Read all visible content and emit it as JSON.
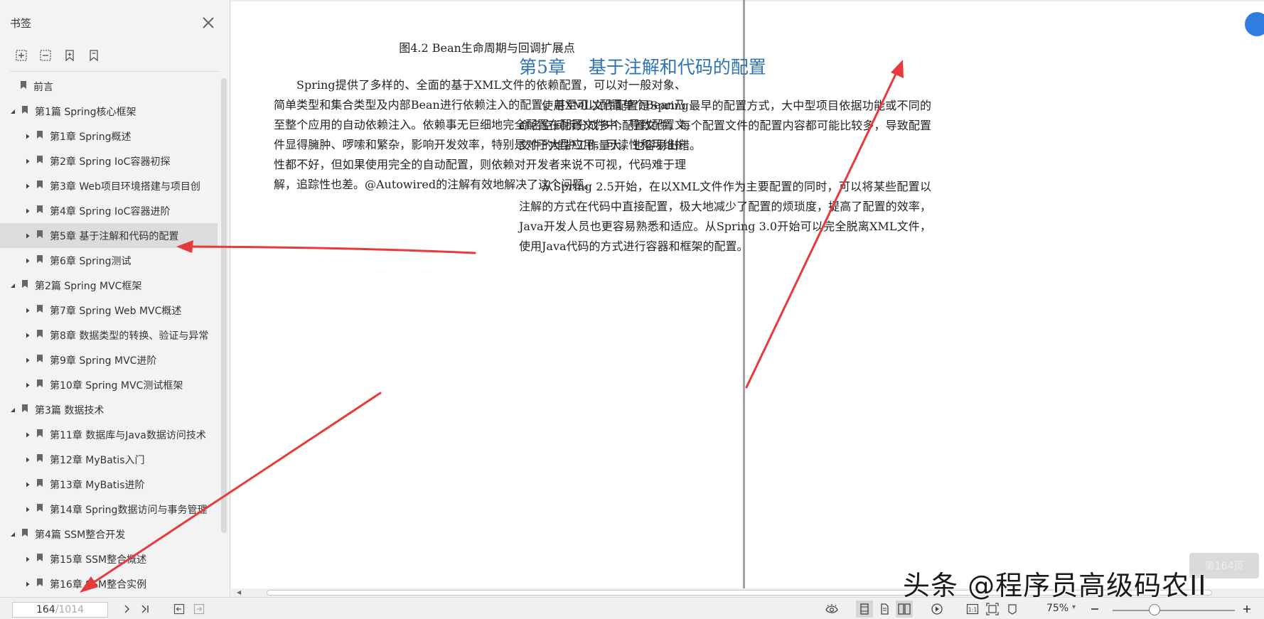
{
  "sidebar": {
    "title": "书签",
    "items": [
      {
        "label": "前言",
        "level": 0,
        "expanded": false
      },
      {
        "label": "第1篇 Spring核心框架",
        "level": 1,
        "expanded": true
      },
      {
        "label": "第1章 Spring概述",
        "level": 2,
        "expanded": false
      },
      {
        "label": "第2章 Spring IoC容器初探",
        "level": 2,
        "expanded": false
      },
      {
        "label": "第3章 Web项目环境搭建与项目创",
        "level": 2,
        "expanded": false
      },
      {
        "label": "第4章 Spring IoC容器进阶",
        "level": 2,
        "expanded": false
      },
      {
        "label": "第5章 基于注解和代码的配置",
        "level": 2,
        "expanded": false,
        "selected": true
      },
      {
        "label": "第6章 Spring测试",
        "level": 2,
        "expanded": false
      },
      {
        "label": "第2篇 Spring MVC框架",
        "level": 1,
        "expanded": true
      },
      {
        "label": "第7章 Spring Web MVC概述",
        "level": 2,
        "expanded": false
      },
      {
        "label": "第8章 数据类型的转换、验证与异常",
        "level": 2,
        "expanded": false
      },
      {
        "label": "第9章 Spring MVC进阶",
        "level": 2,
        "expanded": false
      },
      {
        "label": "第10章 Spring MVC测试框架",
        "level": 2,
        "expanded": false
      },
      {
        "label": "第3篇 数据技术",
        "level": 1,
        "expanded": true
      },
      {
        "label": "第11章 数据库与Java数据访问技术",
        "level": 2,
        "expanded": false
      },
      {
        "label": "第12章 MyBatis入门",
        "level": 2,
        "expanded": false
      },
      {
        "label": "第13章 MyBatis进阶",
        "level": 2,
        "expanded": false
      },
      {
        "label": "第14章 Spring数据访问与事务管理",
        "level": 2,
        "expanded": false
      },
      {
        "label": "第4篇 SSM整合开发",
        "level": 1,
        "expanded": true
      },
      {
        "label": "第15章 SSM整合概述",
        "level": 2,
        "expanded": false
      },
      {
        "label": "第16章 SSM整合实例",
        "level": 2,
        "expanded": false
      }
    ]
  },
  "left_page": {
    "caption": "图4.2   Bean生命周期与回调扩展点",
    "paragraph": "Spring提供了多样的、全面的基于XML文件的依赖配置，可以对一般对象、简单类型和集合类型及内部Bean进行依赖注入的配置，甚至可以配置单个Bean乃至整个应用的自动依赖注入。依赖事无巨细地完全配置在配置文件中，导致配置文件显得臃肿、啰嗦和繁杂，影响开发效率，特别是对于大型应用，可读性和可维护性都不好，但如果使用完全的自动配置，则依赖对开发者来说不可视，代码难于理解，追踪性也差。@Autowired的注解有效地解决了这个问题。"
  },
  "right_page": {
    "chapter_title": "第5章    基于注解和代码的配置",
    "paragraph1": "使用XML文件配置是Spring最早的配置方式，大中型项目依据功能或不同的命名空间拆分成多个配置文件，每个配置文件的配置内容都可能比较多，导致配置文件的维护工作量大，也容易出错。",
    "paragraph2": "从Spring 2.5开始，在以XML文件作为主要配置的同时，可以将某些配置以注解的方式在代码中直接配置，极大地减少了配置的烦琐度，提高了配置的效率，Java开发人员也更容易熟悉和适应。从Spring 3.0开始可以完全脱离XML文件，使用Java代码的方式进行容器和框架的配置。"
  },
  "page_badge": "第164页",
  "pagination": {
    "current": "164",
    "total": "/1014"
  },
  "zoom": "75%",
  "watermark": "头条 @程序员高级码农II",
  "colors": {
    "accent": "#2e74b5",
    "arrow": "#e83a3a",
    "selected_bg": "#dcdcde"
  }
}
